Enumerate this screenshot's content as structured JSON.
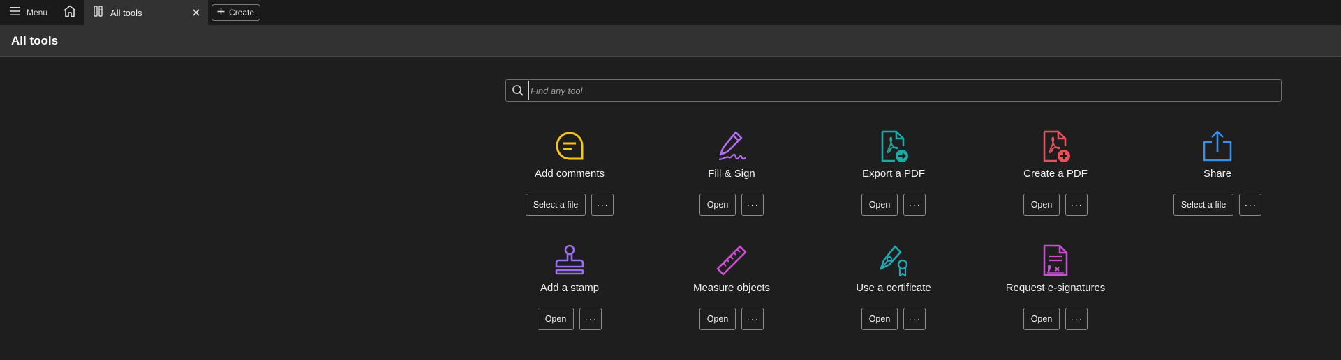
{
  "topbar": {
    "menu_label": "Menu",
    "tab_label": "All tools",
    "create_label": "Create"
  },
  "header": {
    "title": "All tools"
  },
  "search": {
    "placeholder": "Find any tool"
  },
  "colors": {
    "comments": "#f5c518",
    "fill_sign": "#b36ef0",
    "export": "#1fa9a4",
    "create": "#e8505b",
    "share": "#3a8ee6",
    "stamp": "#9b6ef0",
    "measure": "#d04fd6",
    "certificate": "#24a7b3",
    "esign": "#c84fd0"
  },
  "tools": [
    {
      "name": "Add comments",
      "icon": "comment-icon",
      "primary": "Select a file",
      "more": "···"
    },
    {
      "name": "Fill & Sign",
      "icon": "fill-sign-icon",
      "primary": "Open",
      "more": "···"
    },
    {
      "name": "Export a PDF",
      "icon": "export-pdf-icon",
      "primary": "Open",
      "more": "···"
    },
    {
      "name": "Create a PDF",
      "icon": "create-pdf-icon",
      "primary": "Open",
      "more": "···"
    },
    {
      "name": "Share",
      "icon": "share-icon",
      "primary": "Select a file",
      "more": "···"
    },
    {
      "name": "Add a stamp",
      "icon": "stamp-icon",
      "primary": "Open",
      "more": "···"
    },
    {
      "name": "Measure objects",
      "icon": "ruler-icon",
      "primary": "Open",
      "more": "···"
    },
    {
      "name": "Use a certificate",
      "icon": "certificate-icon",
      "primary": "Open",
      "more": "···"
    },
    {
      "name": "Request e-signatures",
      "icon": "esign-request-icon",
      "primary": "Open",
      "more": "···"
    }
  ]
}
